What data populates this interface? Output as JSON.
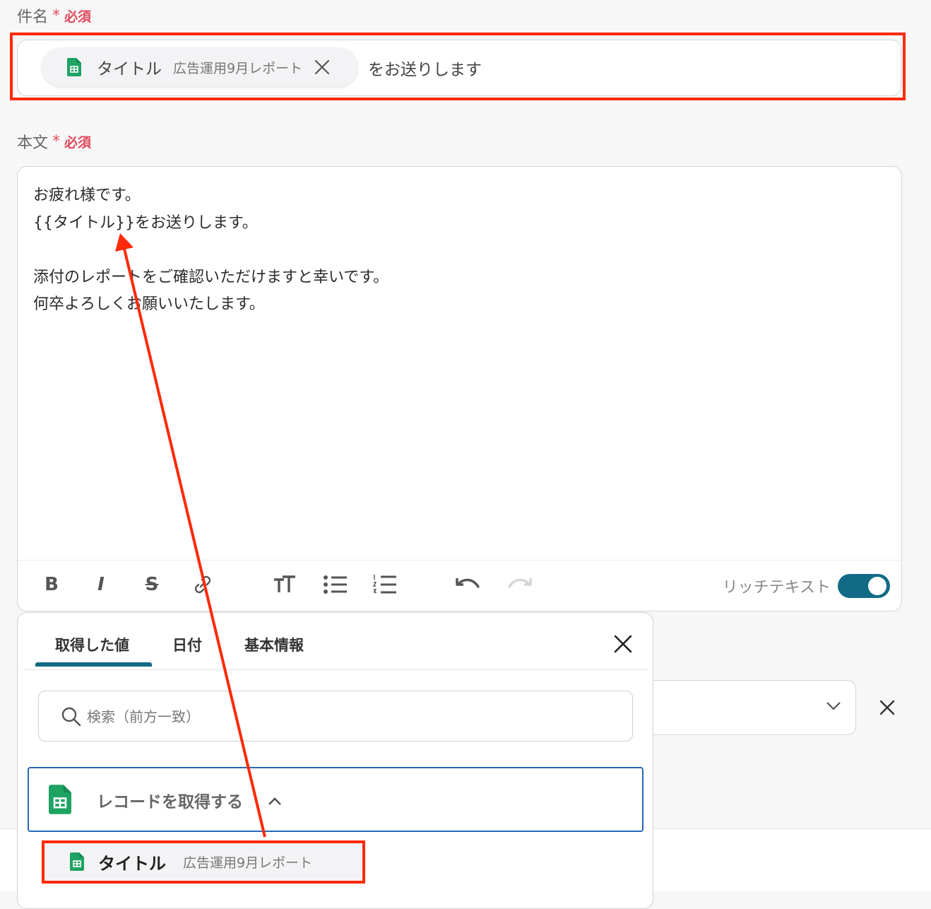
{
  "subject": {
    "label": "件名",
    "required_star": "*",
    "required_text": "必須",
    "chip": {
      "icon": "google-sheets-icon",
      "name": "タイトル",
      "value": "広告運用9月レポート"
    },
    "text_after": "をお送りします"
  },
  "body": {
    "label": "本文",
    "required_star": "*",
    "required_text": "必須",
    "text": "お疲れ様です。\n{{タイトル}}をお送りします。\n\n添付のレポートをご確認いただけますと幸いです。\n何卒よろしくお願いいたします。",
    "toolbar": {
      "bold": "B",
      "italic": "I",
      "strike": "S",
      "rich_text_label": "リッチテキスト",
      "rich_text_enabled": true
    }
  },
  "popup": {
    "tabs": [
      "取得した値",
      "日付",
      "基本情報"
    ],
    "active_tab": 0,
    "search_placeholder": "検索（前方一致）",
    "group": {
      "icon": "google-sheets-icon",
      "label": "レコードを取得する",
      "expanded": true
    },
    "item": {
      "icon": "google-sheets-icon",
      "name": "タイトル",
      "value": "広告運用9月レポート"
    }
  },
  "colors": {
    "required": "#e04a5c",
    "accent": "#136a86",
    "highlight": "#ff2a0a",
    "group_border": "#2866b8",
    "sheets_green": "#1ea362"
  }
}
